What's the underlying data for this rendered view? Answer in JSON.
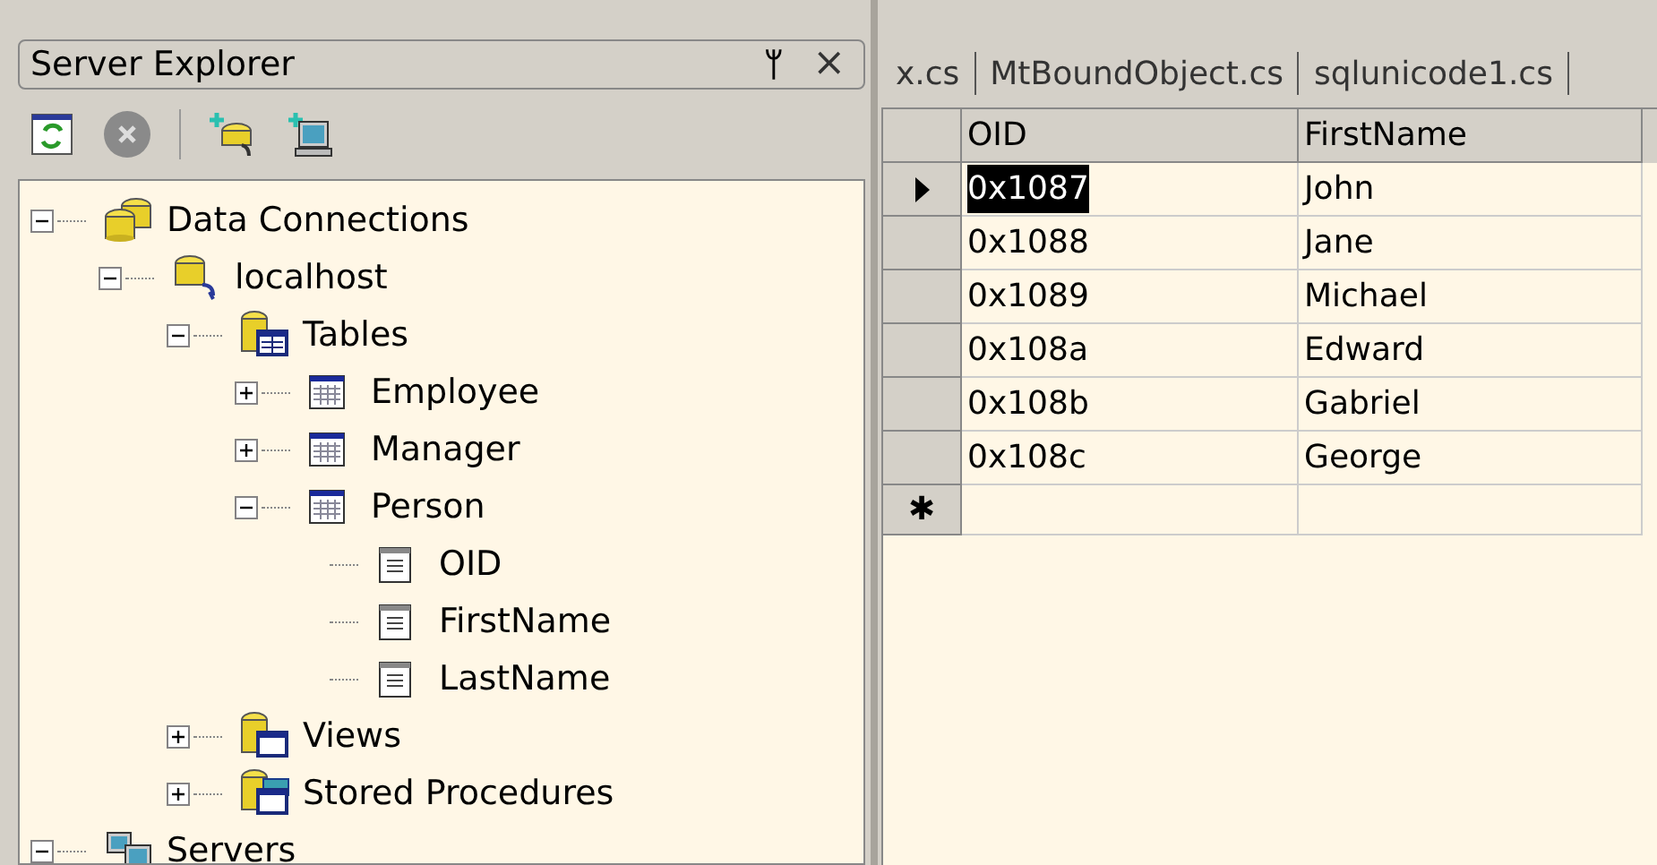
{
  "server_explorer": {
    "title": "Server Explorer",
    "pin_glyph": "ᛘ",
    "close_glyph": "×",
    "tree": [
      {
        "label": "Data Connections",
        "kind": "connections",
        "expanded": true,
        "children": [
          {
            "label": "localhost",
            "kind": "server-db",
            "expanded": true,
            "children": [
              {
                "label": "Tables",
                "kind": "tables",
                "expanded": true,
                "children": [
                  {
                    "label": "Employee",
                    "kind": "table",
                    "expanded": false
                  },
                  {
                    "label": "Manager",
                    "kind": "table",
                    "expanded": false
                  },
                  {
                    "label": "Person",
                    "kind": "table",
                    "expanded": true,
                    "children": [
                      {
                        "label": "OID",
                        "kind": "column"
                      },
                      {
                        "label": "FirstName",
                        "kind": "column"
                      },
                      {
                        "label": "LastName",
                        "kind": "column"
                      }
                    ]
                  }
                ]
              },
              {
                "label": "Views",
                "kind": "views",
                "expanded": false
              },
              {
                "label": "Stored Procedures",
                "kind": "procedures",
                "expanded": false
              }
            ]
          }
        ]
      },
      {
        "label": "Servers",
        "kind": "servers",
        "expanded": true
      }
    ]
  },
  "tabs": [
    {
      "label": "x.cs",
      "selected": false
    },
    {
      "label": "MtBoundObject.cs",
      "selected": false
    },
    {
      "label": "sqlunicode1.cs",
      "selected": false
    }
  ],
  "grid": {
    "columns": [
      "OID",
      "FirstName"
    ],
    "new_row_marker": "✱",
    "rows": [
      {
        "cells": [
          "0x1087",
          "John"
        ],
        "selected": true
      },
      {
        "cells": [
          "0x1088",
          "Jane"
        ],
        "selected": false
      },
      {
        "cells": [
          "0x1089",
          "Michael"
        ],
        "selected": false
      },
      {
        "cells": [
          "0x108a",
          "Edward"
        ],
        "selected": false
      },
      {
        "cells": [
          "0x108b",
          "Gabriel"
        ],
        "selected": false
      },
      {
        "cells": [
          "0x108c",
          "George"
        ],
        "selected": false
      }
    ]
  }
}
